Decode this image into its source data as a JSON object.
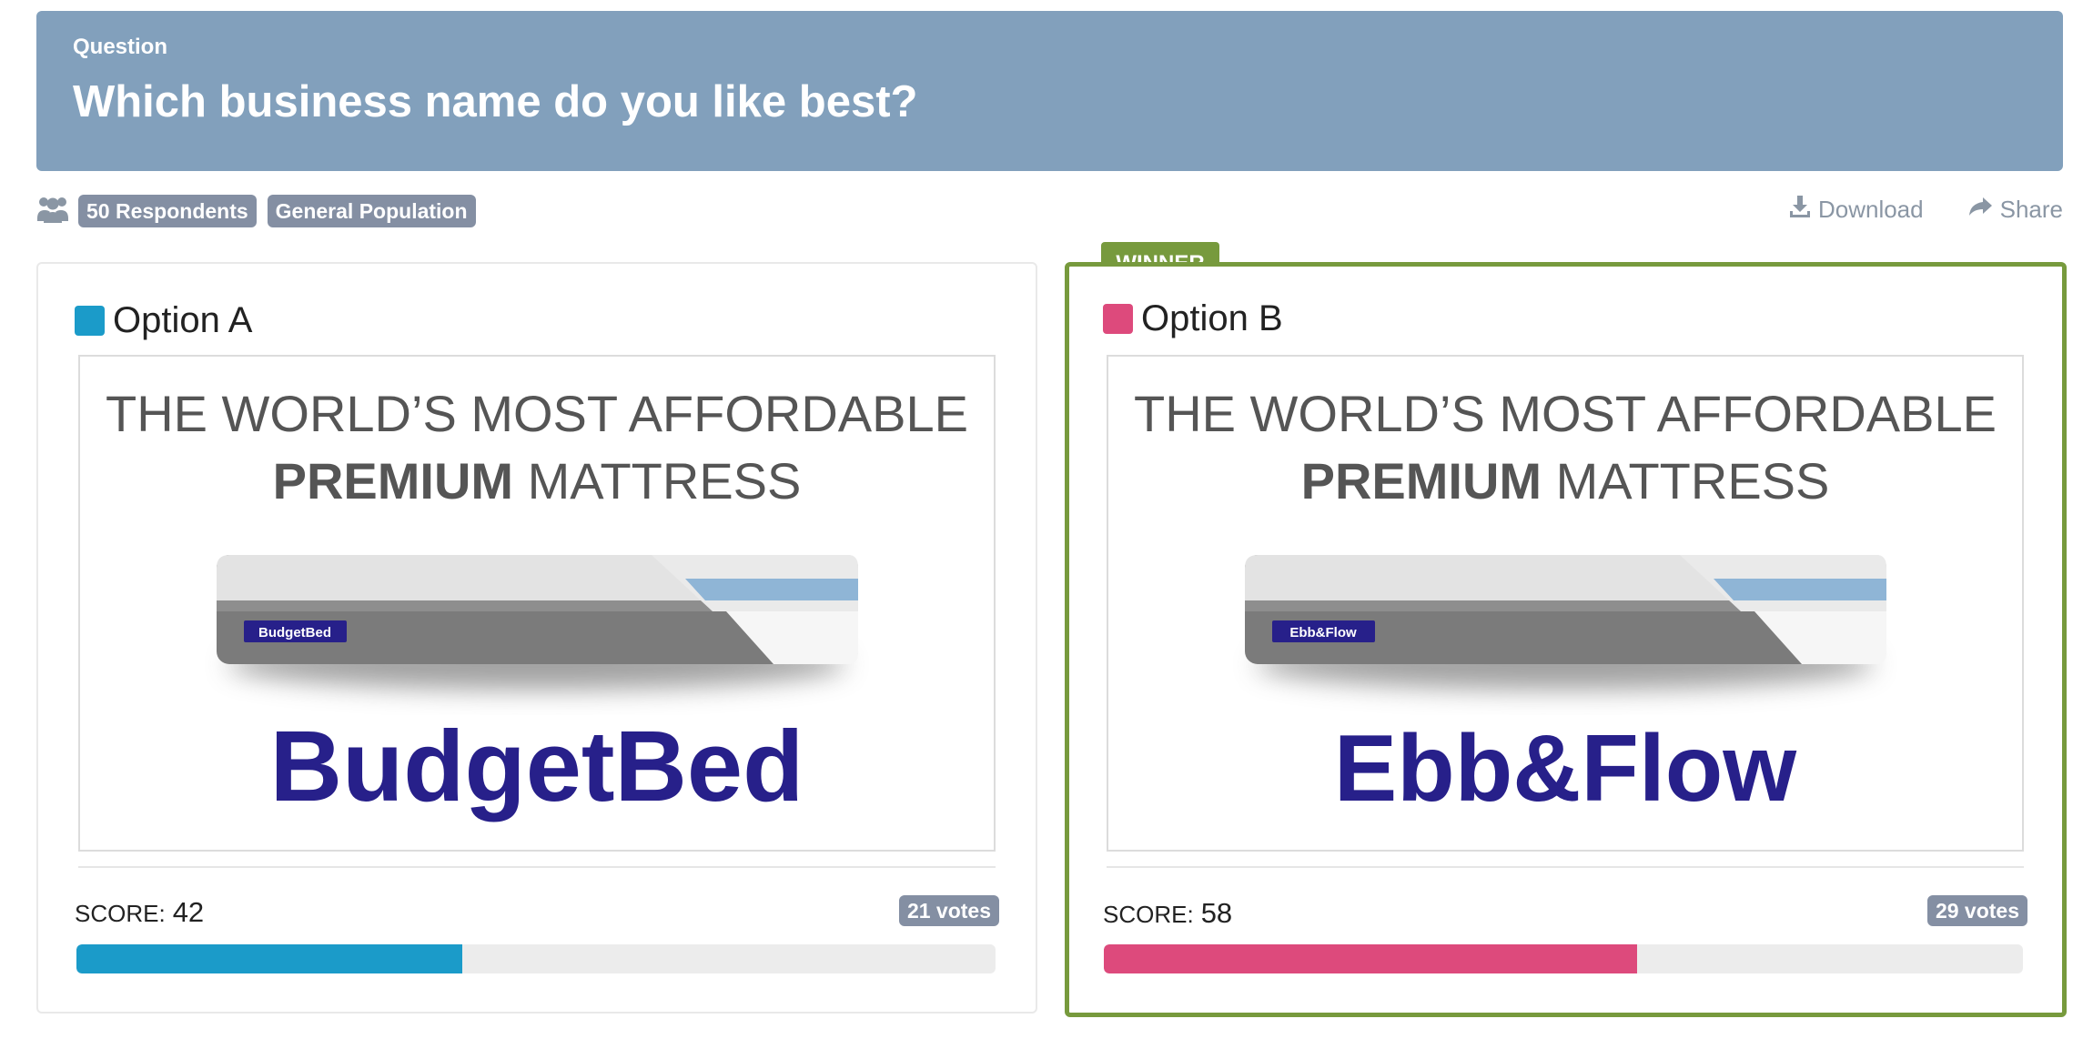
{
  "question": {
    "label": "Question",
    "text": "Which business name do you like best?"
  },
  "meta": {
    "icon": "users-icon",
    "respondents": "50 Respondents",
    "audience": "General Population"
  },
  "actions": {
    "download": "Download",
    "share": "Share"
  },
  "winner_label": "WINNER",
  "score_label": "SCORE:",
  "ad_text": {
    "headline_1": "THE WORLD’S MOST AFFORDABLE",
    "headline_bold": "PREMIUM",
    "headline_rest": " MATTRESS"
  },
  "options": [
    {
      "title": "Option A",
      "color": "#1b9bc9",
      "brand": "BudgetBed",
      "score": "42",
      "score_fraction": 0.42,
      "votes": "21 votes"
    },
    {
      "title": "Option B",
      "color": "#dd4a7c",
      "brand": "Ebb&Flow",
      "score": "58",
      "score_fraction": 0.58,
      "votes": "29 votes"
    }
  ],
  "colors": {
    "banner": "#82a0bc",
    "winner": "#779a3d",
    "badge": "#848fa3",
    "brand_text": "#27208a"
  }
}
